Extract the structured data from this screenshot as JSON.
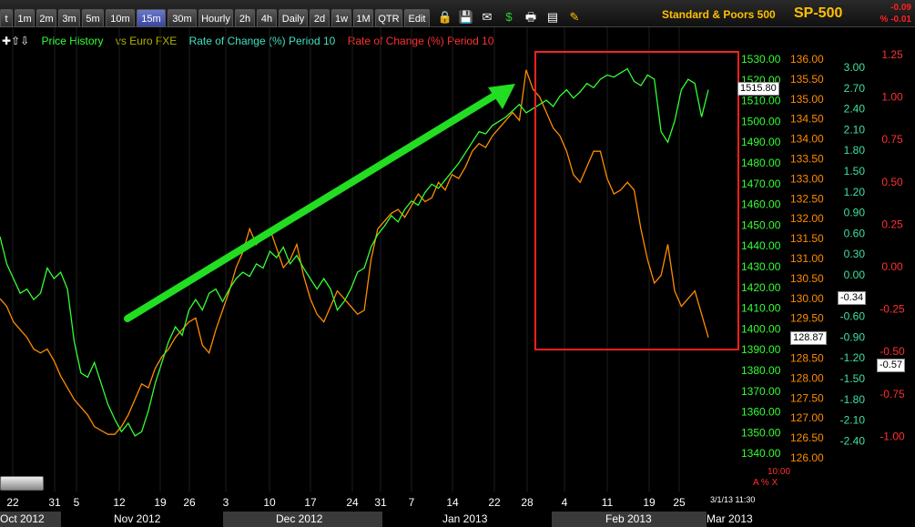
{
  "toolbar": {
    "buttons": [
      {
        "label": "t",
        "left": 0,
        "width": 14
      },
      {
        "label": "1m",
        "left": 16,
        "width": 22
      },
      {
        "label": "2m",
        "left": 40,
        "width": 22
      },
      {
        "label": "3m",
        "left": 64,
        "width": 24
      },
      {
        "label": "5m",
        "left": 90,
        "width": 24
      },
      {
        "label": "10m",
        "left": 116,
        "width": 32
      },
      {
        "label": "15m",
        "left": 150,
        "width": 32,
        "active": true
      },
      {
        "label": "30m",
        "left": 184,
        "width": 32
      },
      {
        "label": "Hourly",
        "left": 218,
        "width": 38
      },
      {
        "label": "2h",
        "left": 258,
        "width": 22
      },
      {
        "label": "4h",
        "left": 282,
        "width": 22
      },
      {
        "label": "Daily",
        "left": 306,
        "width": 32
      },
      {
        "label": "2d",
        "left": 340,
        "width": 22
      },
      {
        "label": "1w",
        "left": 364,
        "width": 22
      },
      {
        "label": "1M",
        "left": 388,
        "width": 22
      },
      {
        "label": "QTR",
        "left": 412,
        "width": 30
      },
      {
        "label": "Edit",
        "left": 444,
        "width": 28
      }
    ],
    "icons": [
      {
        "name": "lock-icon",
        "glyph": "🔒",
        "left": 480,
        "color": "#ffc000"
      },
      {
        "name": "save-icon",
        "glyph": "💾",
        "left": 503,
        "color": "#6da0ff"
      },
      {
        "name": "mail-icon",
        "glyph": "✉",
        "left": 526,
        "color": "#ffffff"
      },
      {
        "name": "dollar-icon",
        "glyph": "$",
        "left": 550,
        "color": "#2ecc40"
      },
      {
        "name": "print-icon",
        "glyph": "🖶",
        "left": 574,
        "color": "#ffffff"
      },
      {
        "name": "settings-icon",
        "glyph": "▤",
        "left": 598,
        "color": "#ffffff"
      },
      {
        "name": "pencil-icon",
        "glyph": "✎",
        "left": 622,
        "color": "#ffc000"
      }
    ],
    "title": "Standard & Poors 500",
    "symbol": "SP-500",
    "change_1": "-0.09",
    "change_2": "% -0.01"
  },
  "legend": {
    "price": "Price History",
    "euro": "vs Euro FXE",
    "roc_green": "Rate of Change (%) Period 10",
    "roc_red": "Rate of Change (%) Period 10"
  },
  "colors": {
    "spx": "#33ff33",
    "fxe": "#ff8c00",
    "roc_axis": "#40e0a0",
    "roc_red_axis": "#ff3030",
    "arrow": "#22dd22",
    "box": "#ff2020"
  },
  "axes": {
    "spx": [
      "1530.00",
      "1520.00",
      "1510.00",
      "1500.00",
      "1490.00",
      "1480.00",
      "1470.00",
      "1460.00",
      "1450.00",
      "1440.00",
      "1430.00",
      "1420.00",
      "1410.00",
      "1400.00",
      "1390.00",
      "1380.00",
      "1370.00",
      "1360.00",
      "1350.00",
      "1340.00"
    ],
    "fxe": [
      "136.00",
      "135.50",
      "135.00",
      "134.50",
      "134.00",
      "133.50",
      "133.00",
      "132.50",
      "132.00",
      "131.50",
      "131.00",
      "130.50",
      "130.00",
      "129.50",
      "129.00",
      "128.50",
      "128.00",
      "127.50",
      "127.00",
      "126.50",
      "126.00"
    ],
    "roc": [
      "3.00",
      "2.70",
      "2.40",
      "2.10",
      "1.80",
      "1.50",
      "1.20",
      "0.90",
      "0.60",
      "0.30",
      "0.00",
      "-0.30",
      "-0.60",
      "-0.90",
      "-1.20",
      "-1.50",
      "-1.80",
      "-2.10",
      "-2.40"
    ],
    "roc_red": [
      "1.25",
      "1.00",
      "0.75",
      "0.50",
      "0.25",
      "0.00",
      "-0.25",
      "-0.50",
      "-0.75",
      "-1.00"
    ]
  },
  "value_boxes": {
    "spx": "1515.80",
    "fxe": "128.87",
    "roc": "-0.34",
    "roc_red": "-0.57"
  },
  "dates": [
    "22",
    "31",
    "5",
    "12",
    "19",
    "26",
    "3",
    "10",
    "17",
    "24",
    "31",
    "7",
    "14",
    "22",
    "28",
    "4",
    "11",
    "19",
    "25"
  ],
  "months": [
    "Oct 2012",
    "Nov 2012",
    "Dec 2012",
    "Jan 2013",
    "Feb 2013",
    "Mar 2013"
  ],
  "timestamp": "3/1/13 11:30",
  "small_red": "10:00",
  "corner_label": "A % X",
  "chart_data": {
    "type": "line",
    "series": [
      {
        "name": "Price History",
        "axis": "spx",
        "values": [
          1445,
          1432,
          1425,
          1418,
          1420,
          1415,
          1418,
          1430,
          1425,
          1428,
          1420,
          1395,
          1380,
          1378,
          1385,
          1375,
          1365,
          1358,
          1352,
          1356,
          1350,
          1352,
          1362,
          1375,
          1385,
          1395,
          1402,
          1398,
          1410,
          1415,
          1410,
          1418,
          1420,
          1414,
          1420,
          1425,
          1428,
          1426,
          1432,
          1430,
          1438,
          1435,
          1440,
          1432,
          1436,
          1430,
          1425,
          1420,
          1425,
          1420,
          1410,
          1414,
          1420,
          1428,
          1430,
          1440,
          1446,
          1450,
          1455,
          1452,
          1458,
          1462,
          1460,
          1466,
          1470,
          1468,
          1472,
          1476,
          1480,
          1485,
          1490,
          1495,
          1494,
          1498,
          1500,
          1502,
          1505,
          1508,
          1504,
          1506,
          1508,
          1510,
          1507,
          1512,
          1515,
          1511,
          1514,
          1518,
          1516,
          1520,
          1522,
          1521,
          1523,
          1525,
          1519,
          1517,
          1522,
          1520,
          1495,
          1490,
          1500,
          1515,
          1520,
          1518,
          1502,
          1515
        ]
      },
      {
        "name": "vs Euro FXE",
        "axis": "fxe",
        "values": [
          129.8,
          129.6,
          129.2,
          129.0,
          128.8,
          128.5,
          128.4,
          128.5,
          128.2,
          127.8,
          127.5,
          127.2,
          127.0,
          126.8,
          126.5,
          126.4,
          126.3,
          126.3,
          126.5,
          126.8,
          127.2,
          127.6,
          127.5,
          128.0,
          128.3,
          128.5,
          128.8,
          129.0,
          129.2,
          129.3,
          128.6,
          128.4,
          129.0,
          129.5,
          130.0,
          130.6,
          131.0,
          131.6,
          131.2,
          131.4,
          131.6,
          131.1,
          130.6,
          130.8,
          131.2,
          130.4,
          129.8,
          129.4,
          129.2,
          129.6,
          130.0,
          129.8,
          129.6,
          129.4,
          129.5,
          130.8,
          131.6,
          131.8,
          132.0,
          132.1,
          131.9,
          132.2,
          132.5,
          132.3,
          132.4,
          132.8,
          132.6,
          133.0,
          132.9,
          133.2,
          133.6,
          133.8,
          133.7,
          134.0,
          134.2,
          134.4,
          134.6,
          134.4,
          135.7,
          135.2,
          135.0,
          134.6,
          134.2,
          134.0,
          133.6,
          133.0,
          132.8,
          133.2,
          133.6,
          133.6,
          132.9,
          132.5,
          132.6,
          132.8,
          132.6,
          131.6,
          130.8,
          130.2,
          130.4,
          131.2,
          130.0,
          129.6,
          129.8,
          130.0,
          129.4,
          128.8
        ]
      }
    ],
    "ylim_spx": [
      1340,
      1530
    ],
    "ylim_fxe": [
      126,
      136
    ]
  }
}
